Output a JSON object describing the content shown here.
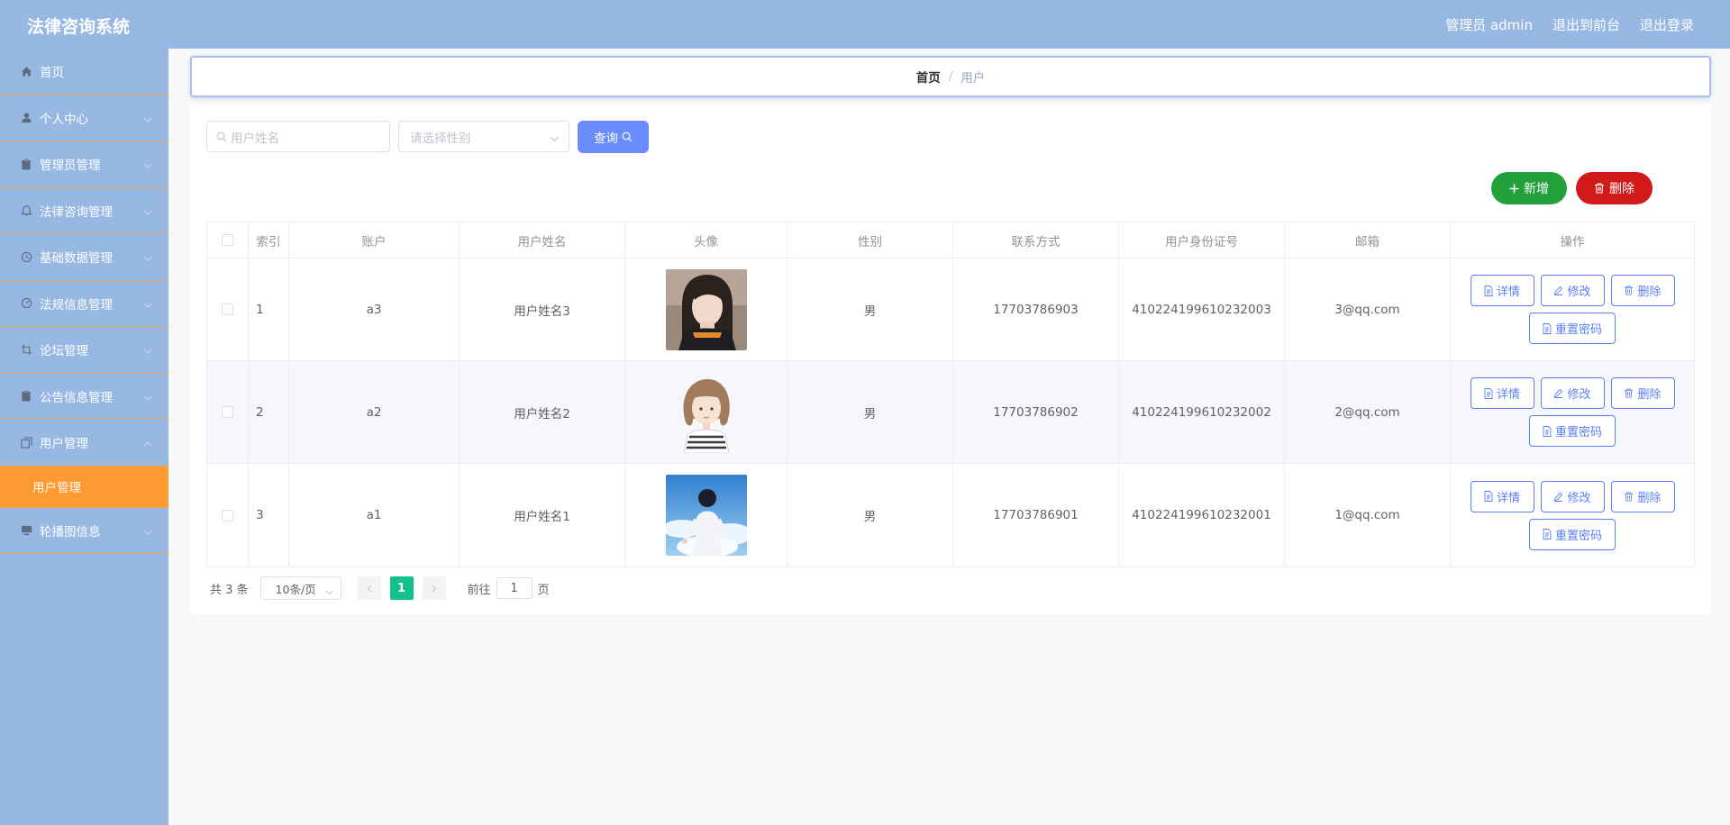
{
  "header": {
    "title": "法律咨询系统",
    "admin_label": "管理员 admin",
    "front_link": "退出到前台",
    "logout_link": "退出登录"
  },
  "sidebar": {
    "items": [
      {
        "label": "首页",
        "icon": "home-icon"
      },
      {
        "label": "个人中心",
        "icon": "user-icon"
      },
      {
        "label": "管理员管理",
        "icon": "clipboard-icon"
      },
      {
        "label": "法律咨询管理",
        "icon": "bell-icon"
      },
      {
        "label": "基础数据管理",
        "icon": "clock-icon"
      },
      {
        "label": "法规信息管理",
        "icon": "dashboard-icon"
      },
      {
        "label": "论坛管理",
        "icon": "crop-icon"
      },
      {
        "label": "公告信息管理",
        "icon": "clipboard-icon"
      },
      {
        "label": "用户管理",
        "icon": "copy-icon"
      },
      {
        "label": "轮播图信息",
        "icon": "monitor-icon"
      }
    ],
    "active_sub": "用户管理"
  },
  "breadcrumb": {
    "home": "首页",
    "separator": "/",
    "current": "用户"
  },
  "search": {
    "name_placeholder": "用户姓名",
    "gender_placeholder": "请选择性别",
    "query_button": "查询"
  },
  "actions": {
    "add_button": "新增",
    "delete_button": "删除"
  },
  "table": {
    "headers": [
      "索引",
      "账户",
      "用户姓名",
      "头像",
      "性别",
      "联系方式",
      "用户身份证号",
      "邮箱",
      "操作"
    ],
    "rows": [
      {
        "index": "1",
        "account": "a3",
        "name": "用户姓名3",
        "gender": "男",
        "phone": "17703786903",
        "id_number": "410224199610232003",
        "email": "3@qq.com"
      },
      {
        "index": "2",
        "account": "a2",
        "name": "用户姓名2",
        "gender": "男",
        "phone": "17703786902",
        "id_number": "410224199610232002",
        "email": "2@qq.com"
      },
      {
        "index": "3",
        "account": "a1",
        "name": "用户姓名1",
        "gender": "男",
        "phone": "17703786901",
        "id_number": "410224199610232001",
        "email": "1@qq.com"
      }
    ],
    "op_labels": {
      "detail": "详情",
      "edit": "修改",
      "delete": "删除",
      "reset": "重置密码"
    }
  },
  "pagination": {
    "total": "共 3 条",
    "page_size": "10条/页",
    "current_page": "1",
    "goto_prefix": "前往",
    "goto_value": "1",
    "goto_suffix": "页"
  },
  "colors": {
    "sidebar_bg": "#97b8e3",
    "active_submenu": "#ff9a33",
    "query_btn": "#6a8cff",
    "add_btn": "#22a13a",
    "del_btn": "#d21a1a",
    "pager_active": "#13c18a"
  }
}
